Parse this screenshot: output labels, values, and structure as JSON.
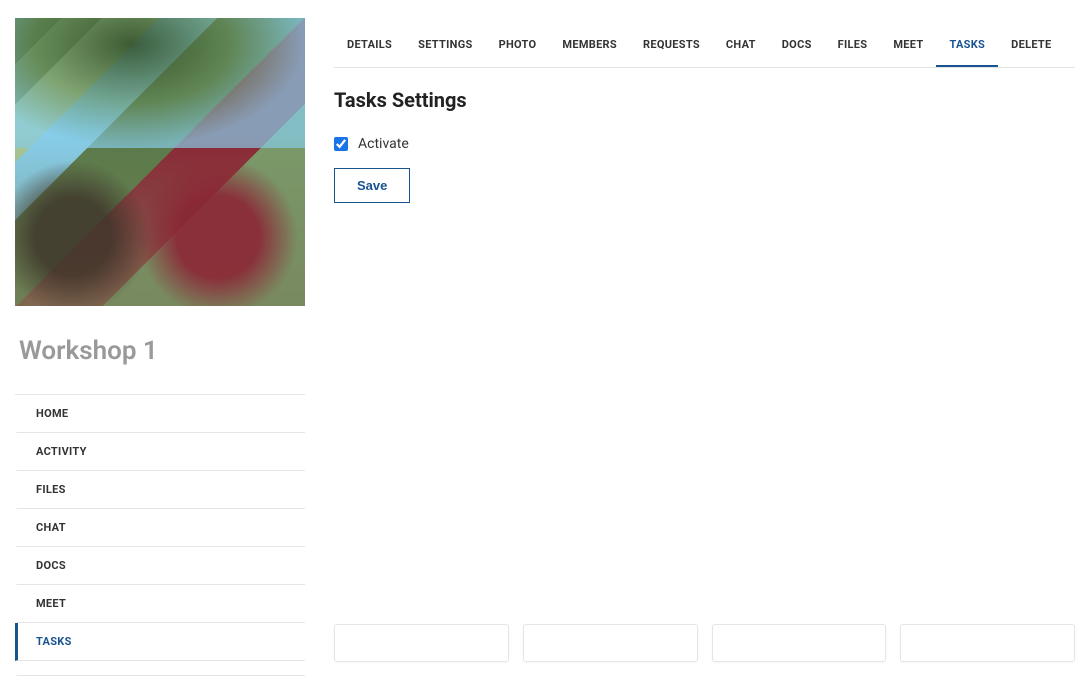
{
  "sidebar": {
    "title": "Workshop 1",
    "items": [
      {
        "label": "HOME",
        "active": false
      },
      {
        "label": "ACTIVITY",
        "active": false
      },
      {
        "label": "FILES",
        "active": false
      },
      {
        "label": "CHAT",
        "active": false
      },
      {
        "label": "DOCS",
        "active": false
      },
      {
        "label": "MEET",
        "active": false
      },
      {
        "label": "TASKS",
        "active": true
      }
    ]
  },
  "tabs": [
    {
      "label": "DETAILS",
      "active": false
    },
    {
      "label": "SETTINGS",
      "active": false
    },
    {
      "label": "PHOTO",
      "active": false
    },
    {
      "label": "MEMBERS",
      "active": false
    },
    {
      "label": "REQUESTS",
      "active": false
    },
    {
      "label": "CHAT",
      "active": false
    },
    {
      "label": "DOCS",
      "active": false
    },
    {
      "label": "FILES",
      "active": false
    },
    {
      "label": "MEET",
      "active": false
    },
    {
      "label": "TASKS",
      "active": true
    },
    {
      "label": "DELETE",
      "active": false
    }
  ],
  "main": {
    "title": "Tasks Settings",
    "activate_label": "Activate",
    "activate_checked": true,
    "save_label": "Save"
  }
}
